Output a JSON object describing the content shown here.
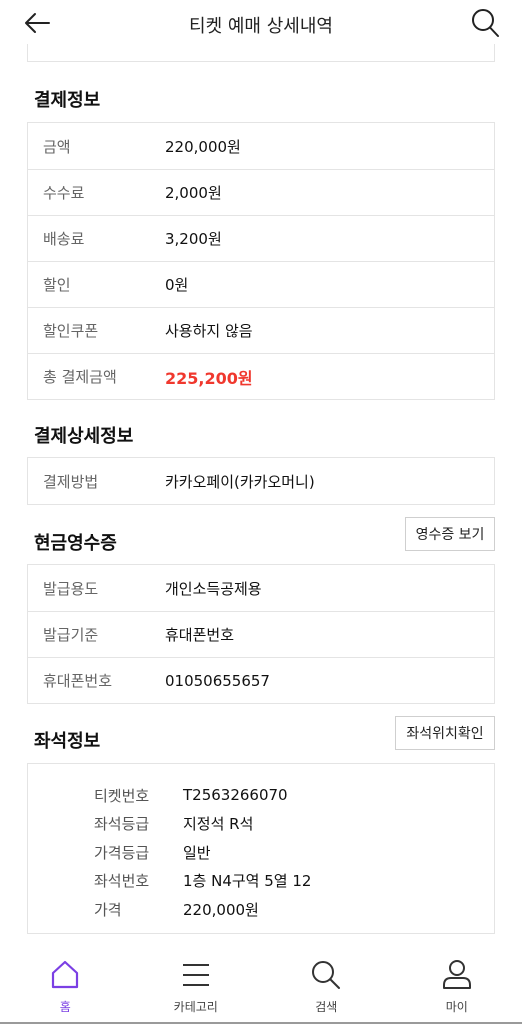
{
  "header": {
    "title": "티켓 예매 상세내역"
  },
  "payment": {
    "title": "결제정보",
    "rows": [
      {
        "label": "금액",
        "value": "220,000원"
      },
      {
        "label": "수수료",
        "value": "2,000원"
      },
      {
        "label": "배송료",
        "value": "3,200원"
      },
      {
        "label": "할인",
        "value": "0원"
      },
      {
        "label": "할인쿠폰",
        "value": "사용하지 않음"
      },
      {
        "label": "총 결제금액",
        "value": "225,200원"
      }
    ]
  },
  "payment_detail": {
    "title": "결제상세정보",
    "rows": [
      {
        "label": "결제방법",
        "value": "카카오페이(카카오머니)"
      }
    ]
  },
  "receipt": {
    "title": "현금영수증",
    "button": "영수증 보기",
    "rows": [
      {
        "label": "발급용도",
        "value": "개인소득공제용"
      },
      {
        "label": "발급기준",
        "value": "휴대폰번호"
      },
      {
        "label": "휴대폰번호",
        "value": "01050655657"
      }
    ]
  },
  "seat": {
    "title": "좌석정보",
    "button": "좌석위치확인",
    "rows": [
      {
        "label": "티켓번호",
        "value": "T2563266070"
      },
      {
        "label": "좌석등급",
        "value": "지정석 R석"
      },
      {
        "label": "가격등급",
        "value": "일반"
      },
      {
        "label": "좌석번호",
        "value": "1층 N4구역 5열 12"
      },
      {
        "label": "가격",
        "value": "220,000원"
      }
    ]
  },
  "tabbar": {
    "items": [
      {
        "label": "홈",
        "icon": "home-icon"
      },
      {
        "label": "카테고리",
        "icon": "menu-icon"
      },
      {
        "label": "검색",
        "icon": "search-icon"
      },
      {
        "label": "마이",
        "icon": "person-icon"
      }
    ]
  },
  "colors": {
    "accent": "#7b3fe4",
    "total": "#f0382e"
  }
}
